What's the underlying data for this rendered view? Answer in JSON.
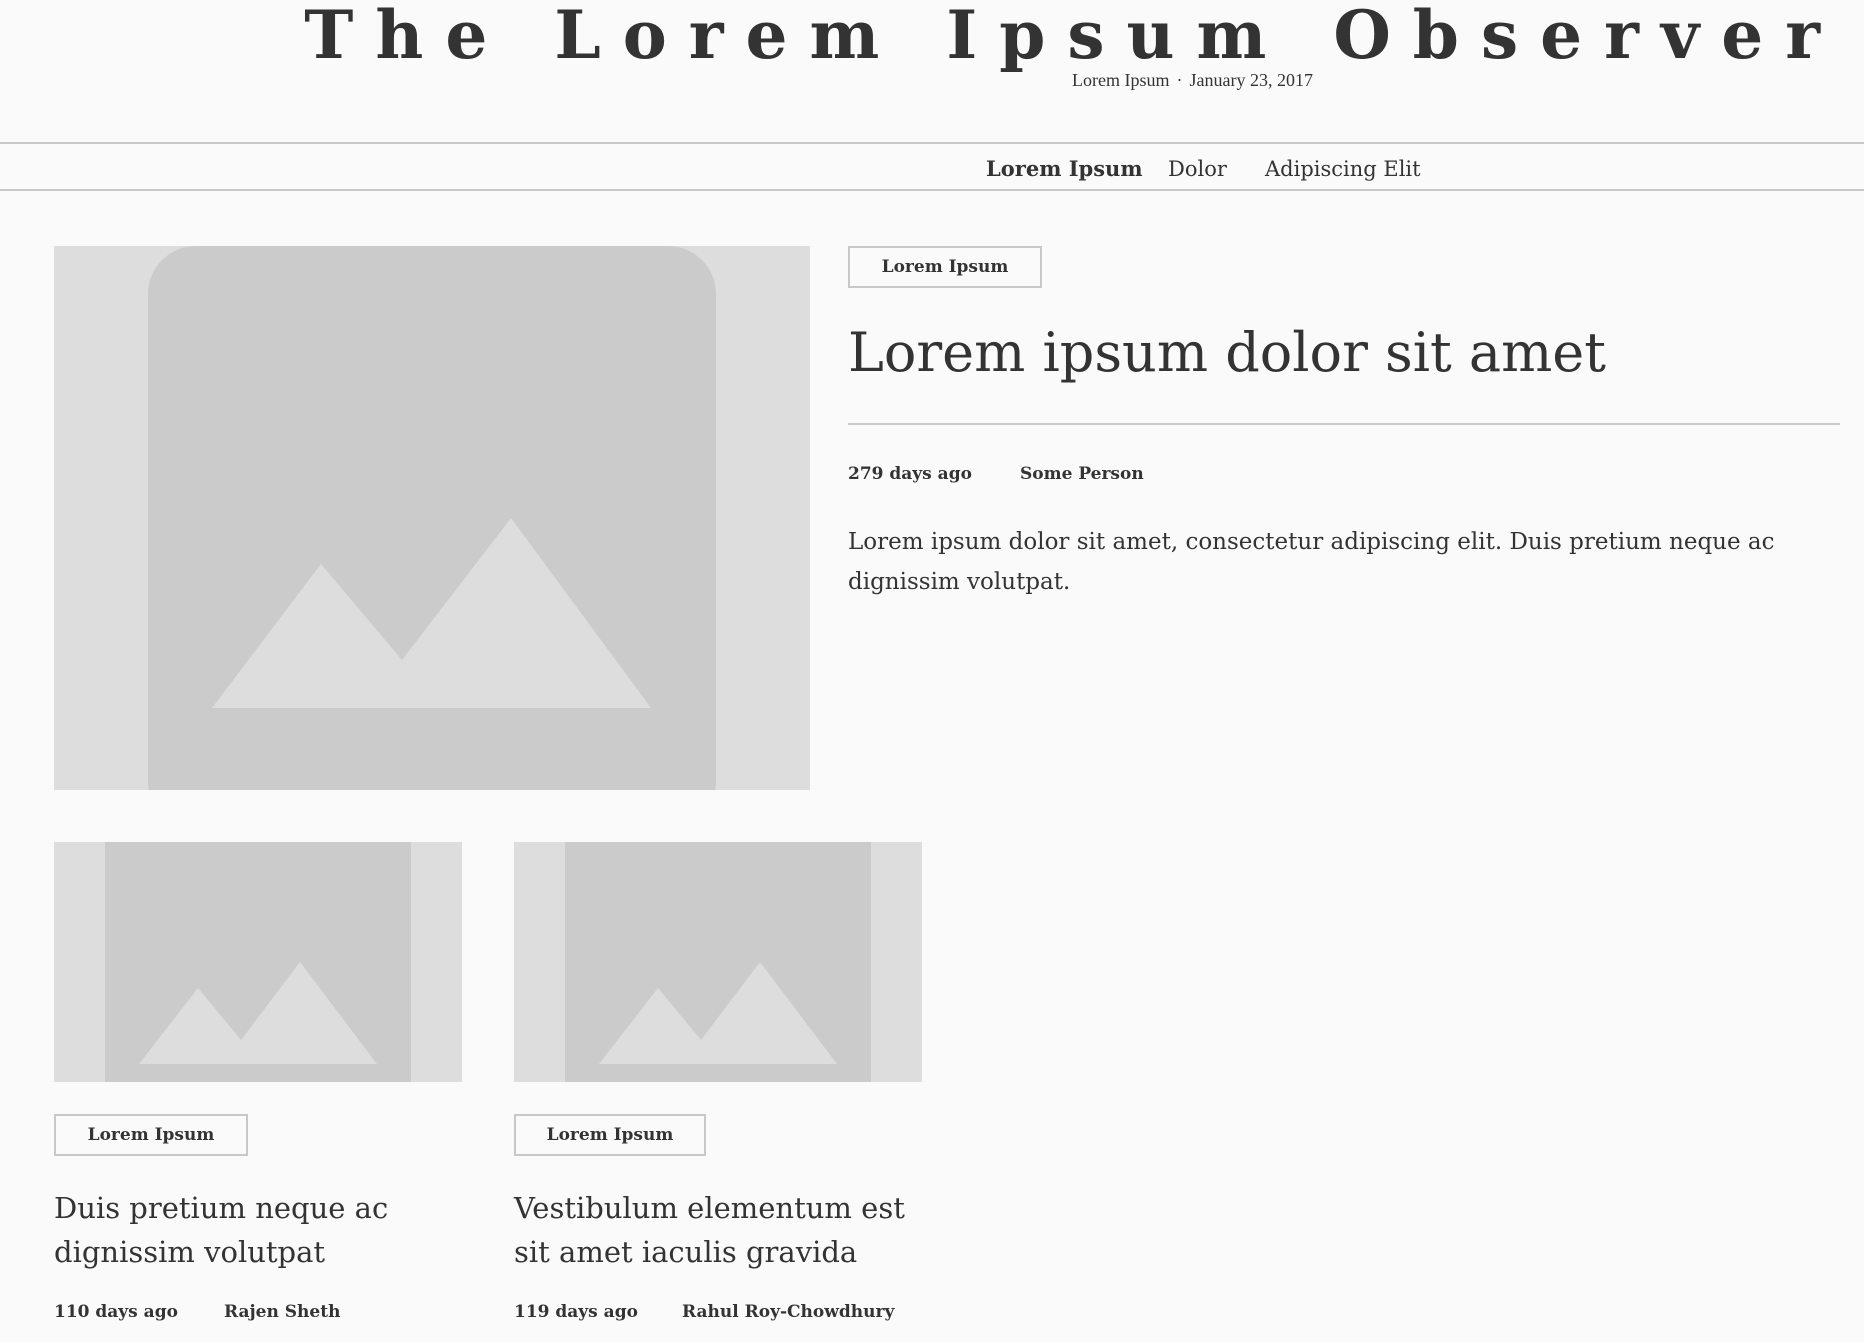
{
  "masthead": {
    "title": "The Lorem Ipsum Observer",
    "section": "Lorem Ipsum",
    "separator": "·",
    "date": "January 23, 2017"
  },
  "nav": {
    "items": [
      {
        "label": "Lorem Ipsum",
        "active": true
      },
      {
        "label": "Dolor",
        "active": false
      },
      {
        "label": "Adipiscing Elit",
        "active": false
      }
    ]
  },
  "feature": {
    "tag": "Lorem Ipsum",
    "title": "Lorem ipsum dolor sit amet",
    "age": "279 days ago",
    "author": "Some Person",
    "excerpt": "Lorem ipsum dolor sit amet, consectetur adipiscing elit. Duis pretium neque ac dignissim volutpat.",
    "image_icon": "image-placeholder-icon"
  },
  "cards": [
    {
      "tag": "Lorem Ipsum",
      "title": "Duis pretium neque ac dignissim volutpat",
      "age": "110 days ago",
      "author": "Rajen Sheth",
      "image_icon": "image-placeholder-icon"
    },
    {
      "tag": "Lorem Ipsum",
      "title": "Vestibulum elementum est sit amet iaculis gravida",
      "age": "119 days ago",
      "author": "Rahul Roy-Chowdhury",
      "image_icon": "image-placeholder-icon"
    }
  ],
  "colors": {
    "background": "#fafafa",
    "text": "#333333",
    "rule": "#c8c8c8",
    "placeholder_bg": "#dddddd",
    "placeholder_fg": "#cbcbcb"
  }
}
